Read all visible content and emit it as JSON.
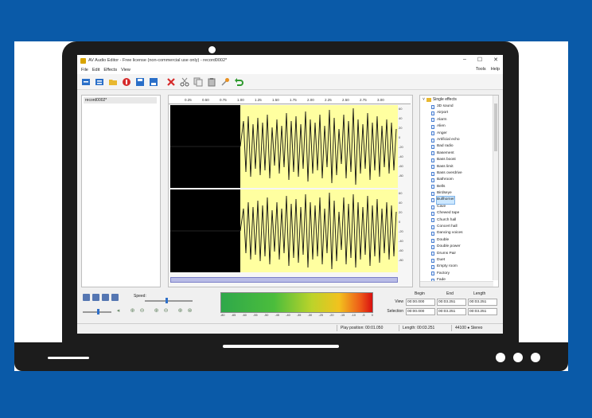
{
  "window": {
    "title": "AV Audio Editor - Free license (non-commercial use only) - record0002*",
    "minimize": "–",
    "maximize": "☐",
    "close": "✕"
  },
  "menu": {
    "left": [
      "File",
      "Edit",
      "Effects",
      "View"
    ],
    "right": [
      "Tools",
      "Help"
    ]
  },
  "toolbar": {
    "icons": [
      "import-icon",
      "export-icon",
      "open-folder-icon",
      "record-icon",
      "save-icon",
      "save-as-icon",
      "delete-icon",
      "cut-icon",
      "copy-icon",
      "paste-icon",
      "microphone-icon",
      "undo-icon"
    ]
  },
  "files": {
    "items": [
      "record0002*"
    ]
  },
  "ruler": {
    "ticks": [
      "0.25",
      "0.50",
      "0.75",
      "1.00",
      "1.25",
      "1.50",
      "1.75",
      "2.00",
      "2.25",
      "2.50",
      "2.75",
      "3.00"
    ]
  },
  "scale": {
    "labels": [
      "60",
      "40",
      "20",
      "0",
      "-20",
      "-40",
      "-60",
      "-80"
    ]
  },
  "effects": {
    "root_label": "Single effects",
    "items": [
      "3D sound",
      "Airport",
      "Alarm",
      "Alien",
      "Anger",
      "Artificial echo",
      "Bad radio",
      "Basement",
      "Bass boost",
      "Bass limit",
      "Bass overdrive",
      "Bathroom",
      "Bells",
      "Birdseye",
      "Bullhorner",
      "Cave",
      "Chewed tape",
      "Church hall",
      "Concert hall",
      "Dancing voices",
      "Double",
      "Double power",
      "Drums Pair",
      "Duet",
      "Empty room",
      "Factory",
      "Fade"
    ],
    "selected": "Bullhorner"
  },
  "transport": {
    "speed_label": "Speed:"
  },
  "meter": {
    "labels": [
      "-80",
      "-65",
      "-60",
      "-55",
      "-50",
      "-45",
      "-40",
      "-35",
      "-30",
      "-25",
      "-20",
      "-15",
      "-10",
      "-5",
      "0"
    ]
  },
  "selection": {
    "headers": {
      "begin": "Begin",
      "end": "End",
      "length": "Length"
    },
    "view_label": "View",
    "selection_label": "Selection",
    "view": {
      "begin": "00:00.000",
      "end": "00:03.251",
      "length": "00:03.251"
    },
    "selection": {
      "begin": "00:00.000",
      "end": "00:03.251",
      "length": "00:03.251"
    }
  },
  "status": {
    "play_position": "Play position: 00:01.050",
    "length": "Length: 00:03.251",
    "format": "44100 ● Stereo"
  }
}
